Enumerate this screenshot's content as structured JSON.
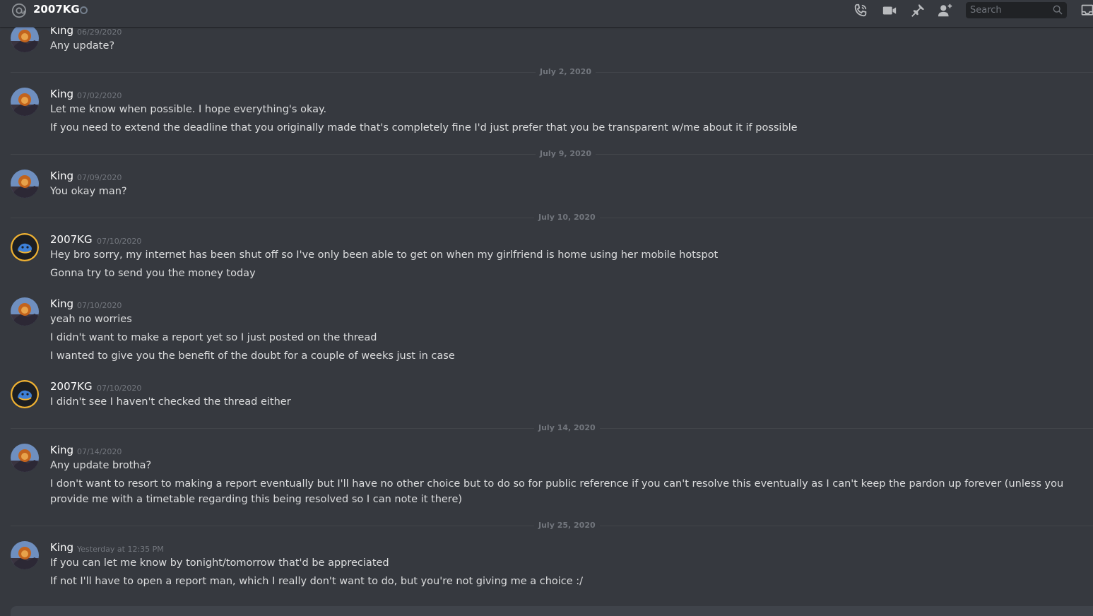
{
  "header": {
    "channel_name": "2007KG",
    "search_placeholder": "Search",
    "icons": [
      "at-icon",
      "call-icon",
      "video-icon",
      "pin-icon",
      "add-friend-icon",
      "search-icon",
      "inbox-icon"
    ]
  },
  "messages": [
    {
      "author": "King",
      "timestamp": "06/29/2020",
      "lines": [
        "Any update?"
      ]
    },
    {
      "divider": "July 2, 2020"
    },
    {
      "author": "King",
      "timestamp": "07/02/2020",
      "lines": [
        "Let me know when possible. I hope everything's okay.",
        "If you need to extend the deadline that you originally made that's completely fine I'd just prefer that you be transparent w/me about it if possible"
      ]
    },
    {
      "divider": "July 9, 2020"
    },
    {
      "author": "King",
      "timestamp": "07/09/2020",
      "lines": [
        "You okay man?"
      ]
    },
    {
      "divider": "July 10, 2020"
    },
    {
      "author": "2007KG",
      "timestamp": "07/10/2020",
      "lines": [
        "Hey bro sorry, my internet has been shut off so I've only been able to get on when my girlfriend is home using her mobile hotspot",
        "Gonna try to send you the money today"
      ]
    },
    {
      "author": "King",
      "timestamp": "07/10/2020",
      "lines": [
        "yeah no worries",
        "I didn't want to make a report yet so I just posted on the thread",
        "I wanted to give you the benefit of the doubt for a couple of weeks just in case"
      ]
    },
    {
      "author": "2007KG",
      "timestamp": "07/10/2020",
      "lines": [
        "I didn't see I haven't checked the thread either"
      ]
    },
    {
      "divider": "July 14, 2020"
    },
    {
      "author": "King",
      "timestamp": "07/14/2020",
      "lines": [
        "Any update brotha?",
        "I don't want to resort to making a report eventually but I'll have no other choice but to do so for public reference if you can't resolve this eventually as I can't keep the pardon up forever (unless you provide me with a timetable regarding this being resolved so I can note it there)"
      ]
    },
    {
      "divider": "July 25, 2020"
    },
    {
      "author": "King",
      "timestamp": "Yesterday at 12:35 PM",
      "lines": [
        "If you can let me know by tonight/tomorrow that'd be appreciated",
        "If not I'll have to open a report man, which I really don't want to do, but you're not giving me a choice :/"
      ]
    }
  ],
  "colors": {
    "background": "#36393f",
    "muted": "#72767d",
    "text": "#dcddde",
    "kg_ring": "#f0b232"
  }
}
